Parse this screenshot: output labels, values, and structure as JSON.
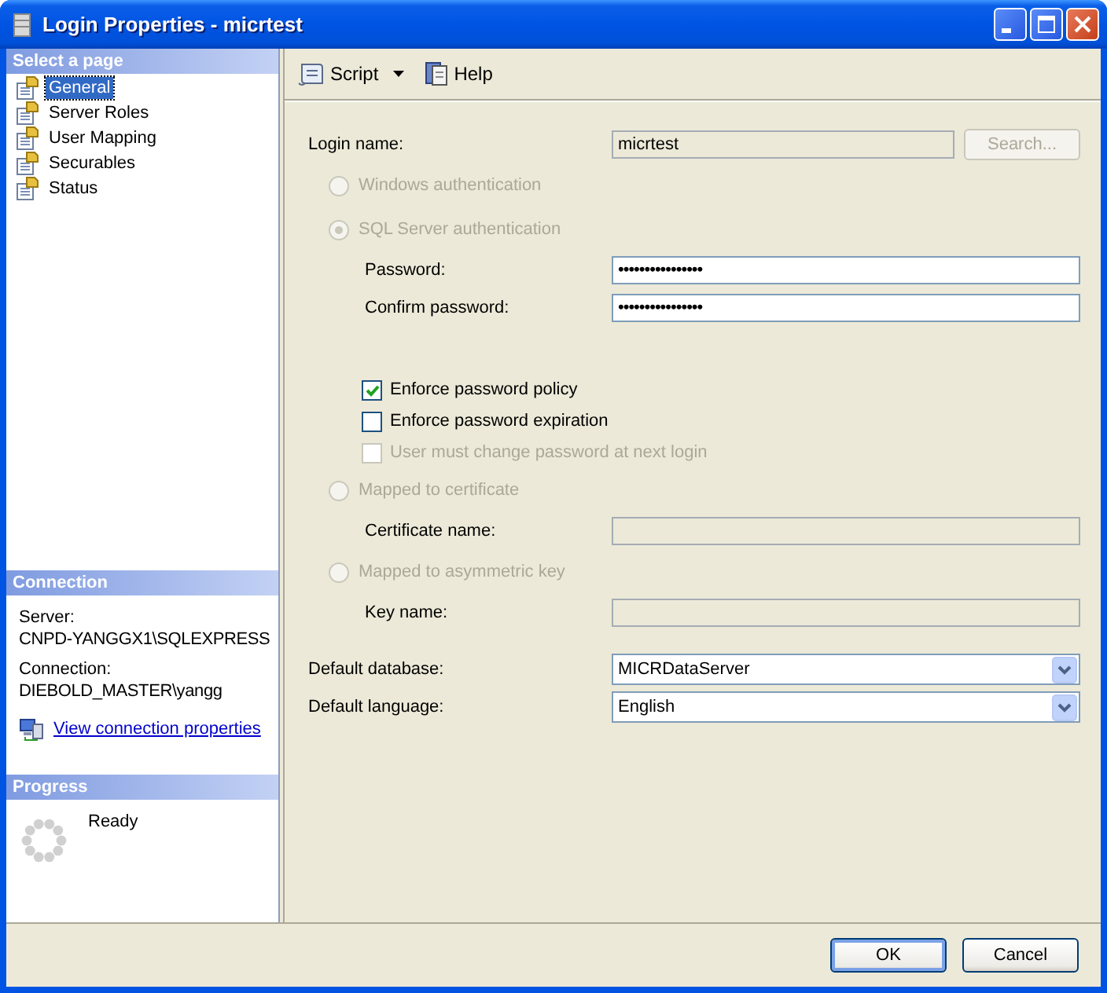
{
  "window": {
    "title": "Login Properties - micrtest"
  },
  "sidebar": {
    "header": "Select a page",
    "items": [
      {
        "label": "General",
        "selected": true
      },
      {
        "label": "Server Roles",
        "selected": false
      },
      {
        "label": "User Mapping",
        "selected": false
      },
      {
        "label": "Securables",
        "selected": false
      },
      {
        "label": "Status",
        "selected": false
      }
    ]
  },
  "connection": {
    "header": "Connection",
    "server_label": "Server:",
    "server": "CNPD-YANGGX1\\SQLEXPRESS",
    "connection_label": "Connection:",
    "connection": "DIEBOLD_MASTER\\yangg",
    "link": "View connection properties"
  },
  "progress": {
    "header": "Progress",
    "status": "Ready"
  },
  "toolbar": [
    {
      "kind": "dropdown",
      "label": "Script"
    },
    {
      "kind": "help",
      "label": "Help"
    }
  ],
  "form": {
    "login_name": {
      "label": "Login name:",
      "value": "micrtest",
      "disabled": true
    },
    "search_button": {
      "label": "Search...",
      "disabled": true
    },
    "auth_options": [
      {
        "label": "Windows authentication",
        "selected": false,
        "disabled": true
      },
      {
        "label": "SQL Server authentication",
        "selected": true,
        "disabled": true,
        "children": [
          {
            "kind": "password",
            "label": "Password:",
            "value": "••••••••••••••••",
            "disabled": false
          },
          {
            "kind": "password",
            "label": "Confirm password:",
            "value": "••••••••••••••••",
            "disabled": false
          },
          {
            "kind": "checkbox",
            "label": "Enforce password policy",
            "checked": true,
            "disabled": false
          },
          {
            "kind": "checkbox",
            "label": "Enforce password expiration",
            "checked": false,
            "disabled": false
          },
          {
            "kind": "checkbox",
            "label": "User must change password at next login",
            "checked": false,
            "disabled": true
          }
        ]
      },
      {
        "label": "Mapped to certificate",
        "selected": false,
        "disabled": true,
        "children": [
          {
            "kind": "field",
            "label": "Certificate name:",
            "disabled": true
          }
        ]
      },
      {
        "label": "Mapped to asymmetric key",
        "selected": false,
        "disabled": true,
        "children": [
          {
            "kind": "field",
            "label": "Key name:",
            "disabled": true
          }
        ]
      }
    ],
    "default_database": {
      "label": "Default database:",
      "value": "MICRDataServer"
    },
    "default_language": {
      "label": "Default language:",
      "value": "English"
    }
  },
  "buttons": [
    {
      "label": "OK",
      "default": true
    },
    {
      "label": "Cancel",
      "default": false
    }
  ]
}
